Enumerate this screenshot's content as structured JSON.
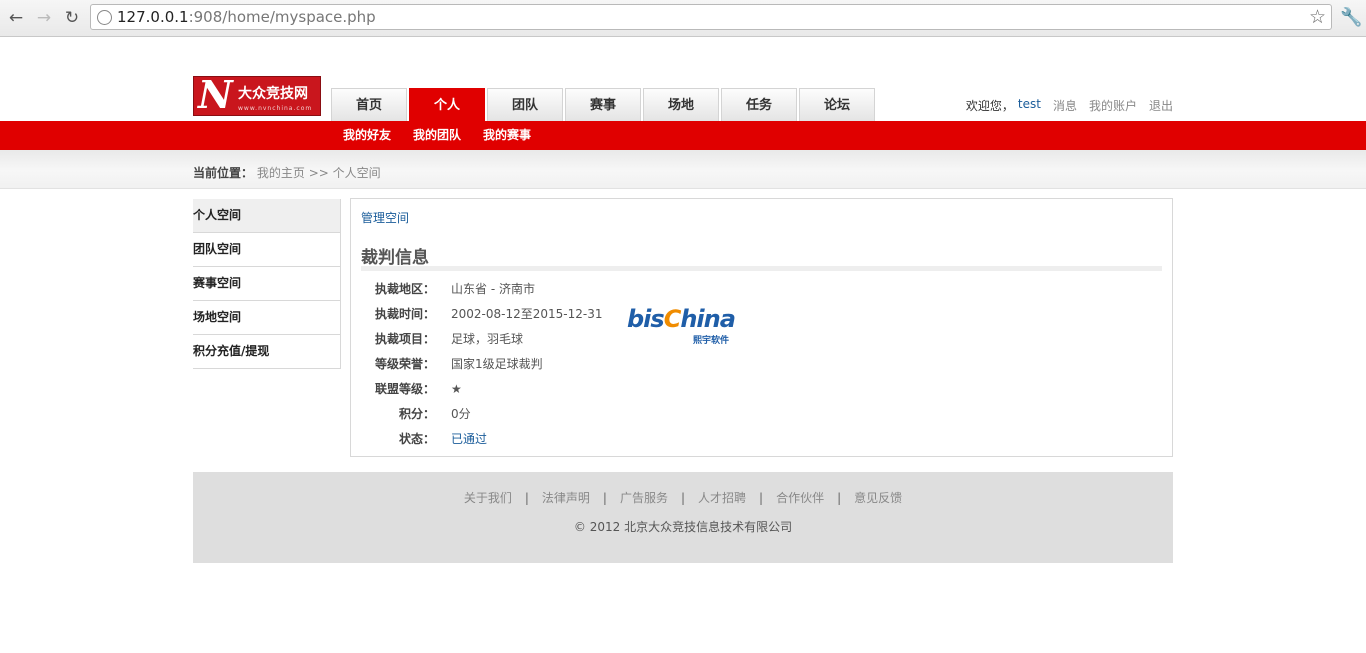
{
  "browser": {
    "url_host": "127.0.0.1",
    "url_rest": ":908/home/myspace.php"
  },
  "header": {
    "logo_letter": "N",
    "logo_name": "大众竞技网",
    "logo_url": "www.nvnchina.com",
    "tabs": [
      {
        "label": "首页",
        "active": false
      },
      {
        "label": "个人",
        "active": true
      },
      {
        "label": "团队",
        "active": false
      },
      {
        "label": "赛事",
        "active": false
      },
      {
        "label": "场地",
        "active": false
      },
      {
        "label": "任务",
        "active": false
      },
      {
        "label": "论坛",
        "active": false
      }
    ],
    "welcome": "欢迎您，",
    "username": "test",
    "messages": "消息",
    "account": "我的账户",
    "logout": "退出",
    "subnav": [
      "我的好友",
      "我的团队",
      "我的赛事"
    ]
  },
  "breadcrumb": {
    "label": "当前位置：",
    "home": "我的主页",
    "sep": ">>",
    "current": "个人空间"
  },
  "sidebar": {
    "items": [
      {
        "label": "个人空间",
        "active": true
      },
      {
        "label": "团队空间",
        "active": false
      },
      {
        "label": "赛事空间",
        "active": false
      },
      {
        "label": "场地空间",
        "active": false
      },
      {
        "label": "积分充值/提现",
        "active": false
      }
    ]
  },
  "main": {
    "manage_link": "管理空间",
    "section_title": "裁判信息",
    "fields": [
      {
        "key": "执裁地区：",
        "value": "山东省 - 济南市"
      },
      {
        "key": "执裁时间：",
        "value": "2002-08-12至2015-12-31"
      },
      {
        "key": "执裁项目：",
        "value": "足球，羽毛球"
      },
      {
        "key": "等级荣誉：",
        "value": "国家1级足球裁判"
      },
      {
        "key": "联盟等级：",
        "value": "★"
      },
      {
        "key": "积分：",
        "value": "0分"
      },
      {
        "key": "状态：",
        "value": "已通过",
        "link": true
      }
    ],
    "watermark": {
      "bis": "bis",
      "c": "C",
      "hina": "hina",
      "sub": "熙宇软件"
    }
  },
  "footer": {
    "links": [
      "关于我们",
      "法律声明",
      "广告服务",
      "人才招聘",
      "合作伙伴",
      "意见反馈"
    ],
    "separator": "|",
    "copyright": "© 2012 北京大众竞技信息技术有限公司"
  },
  "colors": {
    "brand_red": "#e00000",
    "link_blue": "#1a5c9a"
  }
}
